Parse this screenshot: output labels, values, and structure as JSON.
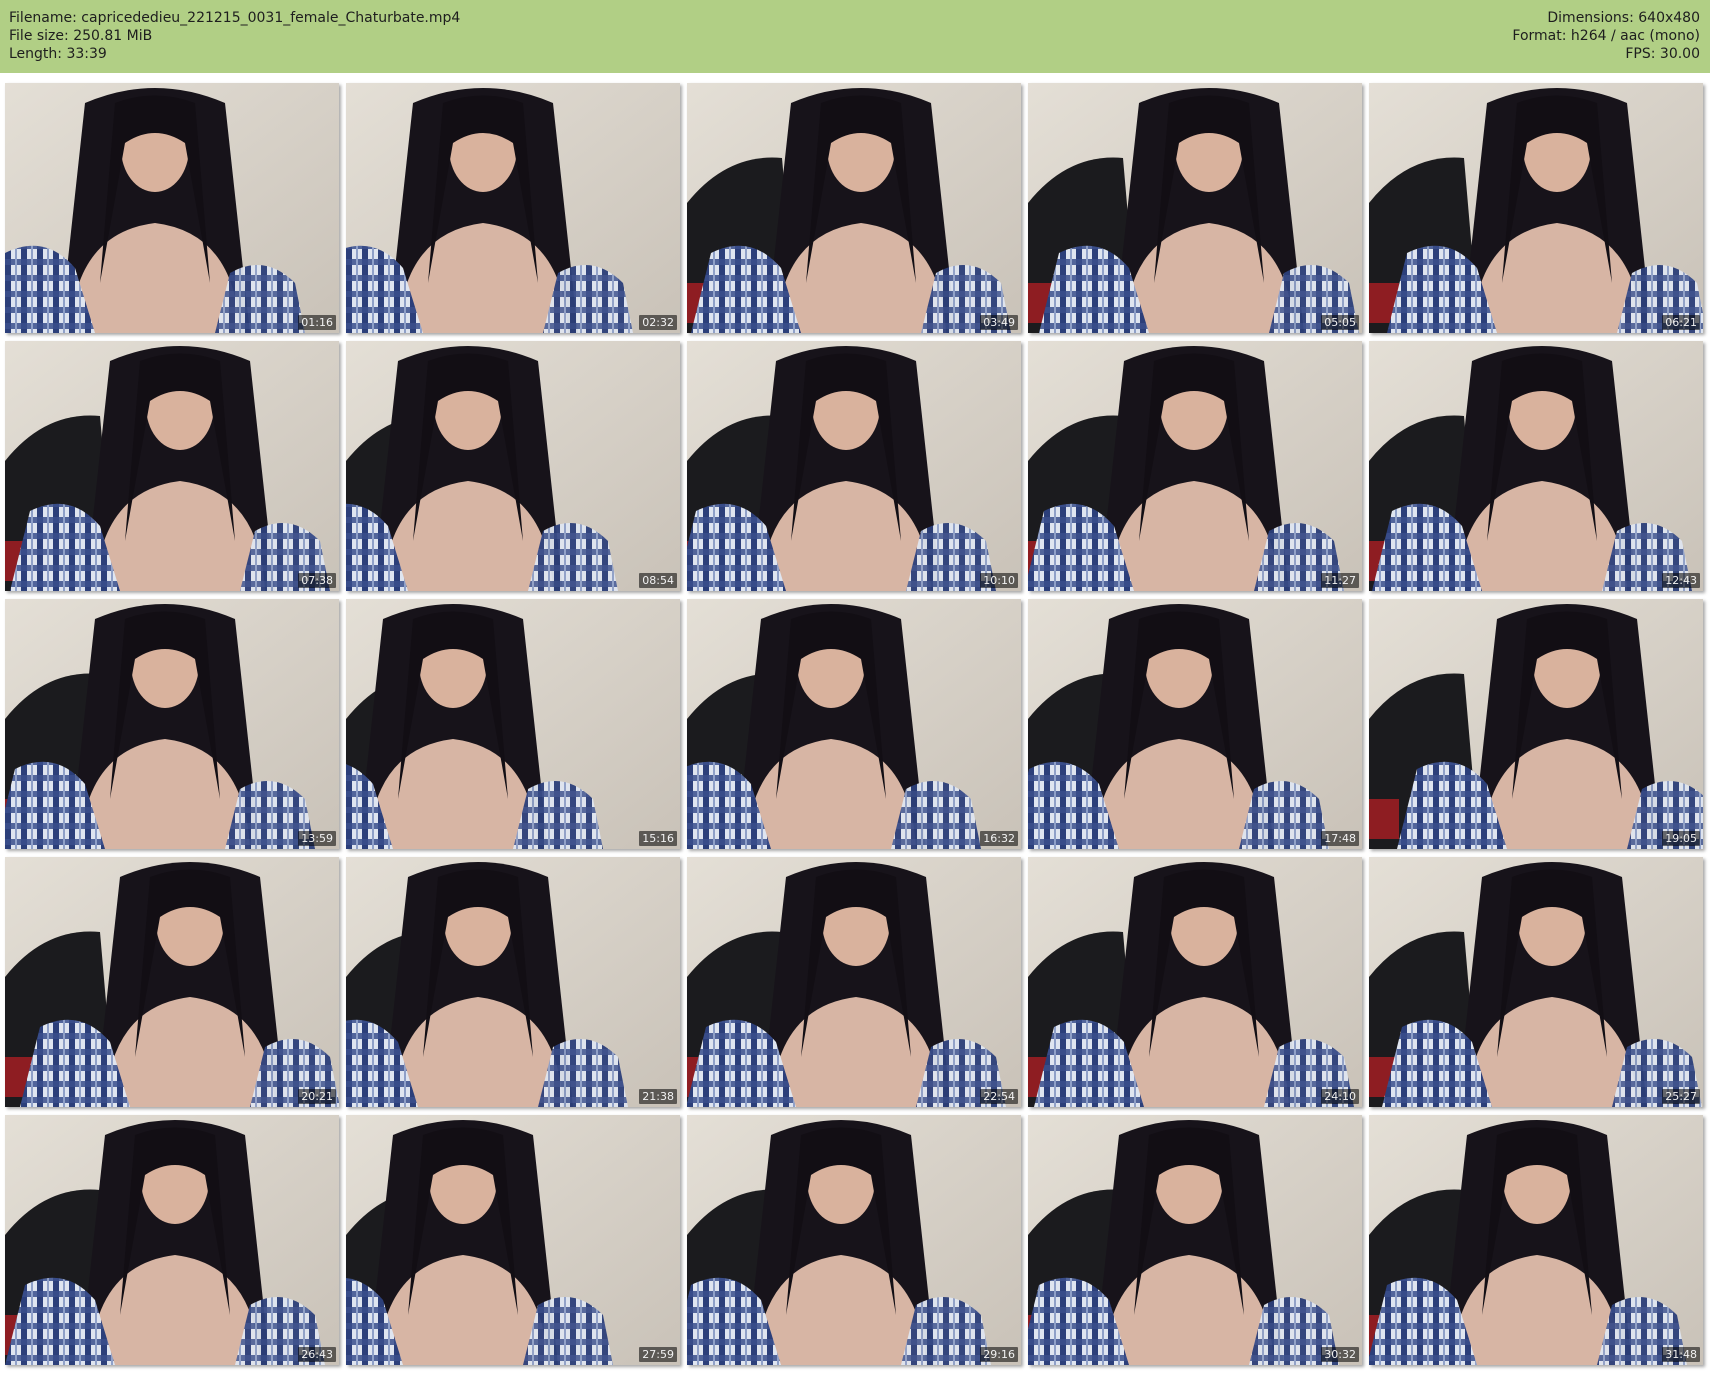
{
  "header": {
    "left": [
      "Filename: capricededieu_221215_0031_female_Chaturbate.mp4",
      "File size: 250.81 MiB",
      "Length: 33:39"
    ],
    "right": [
      "Dimensions: 640x480",
      "Format: h264 / aac (mono)",
      "FPS: 30.00"
    ],
    "background_color": "#b1cf85"
  },
  "thumbnails": [
    {
      "time": "01:16"
    },
    {
      "time": "02:32"
    },
    {
      "time": "03:49"
    },
    {
      "time": "05:05"
    },
    {
      "time": "06:21"
    },
    {
      "time": "07:38"
    },
    {
      "time": "08:54"
    },
    {
      "time": "10:10"
    },
    {
      "time": "11:27"
    },
    {
      "time": "12:43"
    },
    {
      "time": "13:59"
    },
    {
      "time": "15:16"
    },
    {
      "time": "16:32"
    },
    {
      "time": "17:48"
    },
    {
      "time": "19:05"
    },
    {
      "time": "20:21"
    },
    {
      "time": "21:38"
    },
    {
      "time": "22:54"
    },
    {
      "time": "24:10"
    },
    {
      "time": "25:27"
    },
    {
      "time": "26:43"
    },
    {
      "time": "27:59"
    },
    {
      "time": "29:16"
    },
    {
      "time": "30:32"
    },
    {
      "time": "31:48"
    }
  ]
}
